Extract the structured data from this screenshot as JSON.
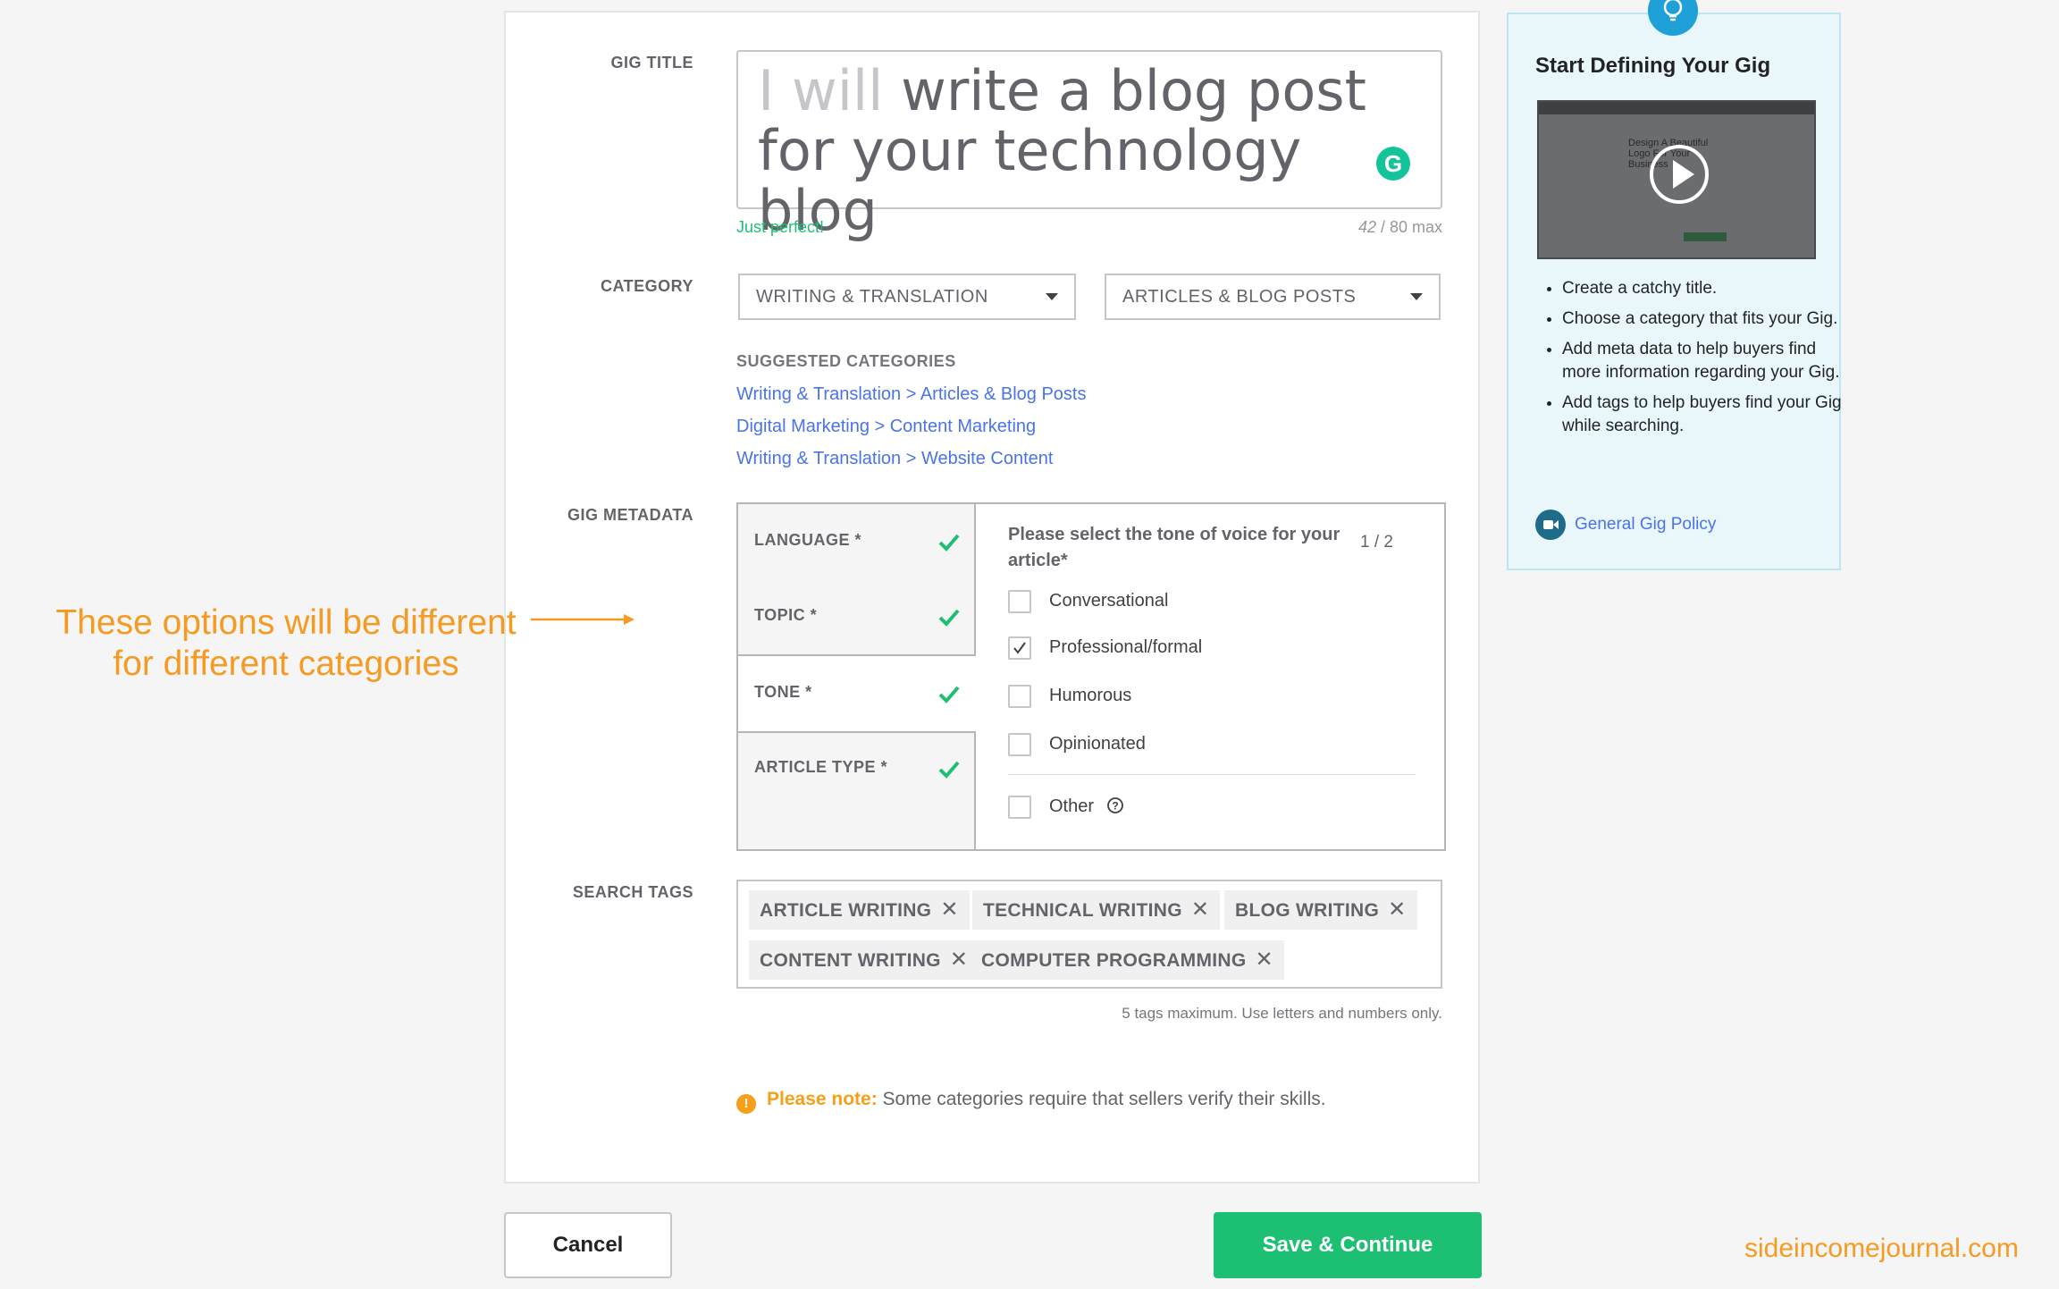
{
  "form": {
    "gig_title": {
      "label": "GIG TITLE",
      "prefix": "I will",
      "value": "write a blog post for your technology blog",
      "validation": "Just perfect!",
      "count": "42",
      "max": " / 80 max"
    },
    "category": {
      "label": "CATEGORY",
      "primary": "WRITING & TRANSLATION",
      "secondary": "ARTICLES & BLOG POSTS",
      "suggested_title": "SUGGESTED CATEGORIES",
      "suggested": [
        "Writing & Translation > Articles & Blog Posts",
        "Digital Marketing > Content Marketing",
        "Writing & Translation > Website Content"
      ]
    },
    "metadata": {
      "label": "GIG METADATA",
      "tabs": [
        "LANGUAGE *",
        "TOPIC *",
        "TONE *",
        "ARTICLE TYPE *"
      ],
      "question": "Please select the tone of voice for your article*",
      "pager": "1 / 2",
      "options": [
        {
          "label": "Conversational",
          "checked": false
        },
        {
          "label": "Professional/formal",
          "checked": true
        },
        {
          "label": "Humorous",
          "checked": false
        },
        {
          "label": "Opinionated",
          "checked": false
        },
        {
          "label": "Other",
          "checked": false
        }
      ]
    },
    "tags": {
      "label": "SEARCH TAGS",
      "items": [
        "ARTICLE WRITING",
        "TECHNICAL WRITING",
        "BLOG WRITING",
        "CONTENT WRITING",
        "COMPUTER PROGRAMMING"
      ],
      "hint": "5 tags maximum. Use letters and numbers only."
    },
    "note": {
      "warn": "Please note:",
      "text": " Some categories require that sellers verify their skills."
    }
  },
  "actions": {
    "cancel": "Cancel",
    "save": "Save & Continue"
  },
  "annotation": {
    "line1": "These options will be different",
    "line2": "for different categories"
  },
  "watermark": "sideincomejournal.com",
  "sidebar": {
    "title": "Start Defining Your Gig",
    "video_text": "Design A Beautiful Logo For Your Business",
    "tips": [
      "Create a catchy title.",
      "Choose a category that fits your Gig.",
      "Add meta data to help buyers find more information regarding your Gig.",
      "Add tags to help buyers find your Gig while searching."
    ],
    "policy": "General Gig Policy"
  },
  "colors": {
    "brand_green": "#1dbf73",
    "link_blue": "#4a73e8",
    "annotation_orange": "#f59a23",
    "panel_bg": "#e9f7fb"
  }
}
